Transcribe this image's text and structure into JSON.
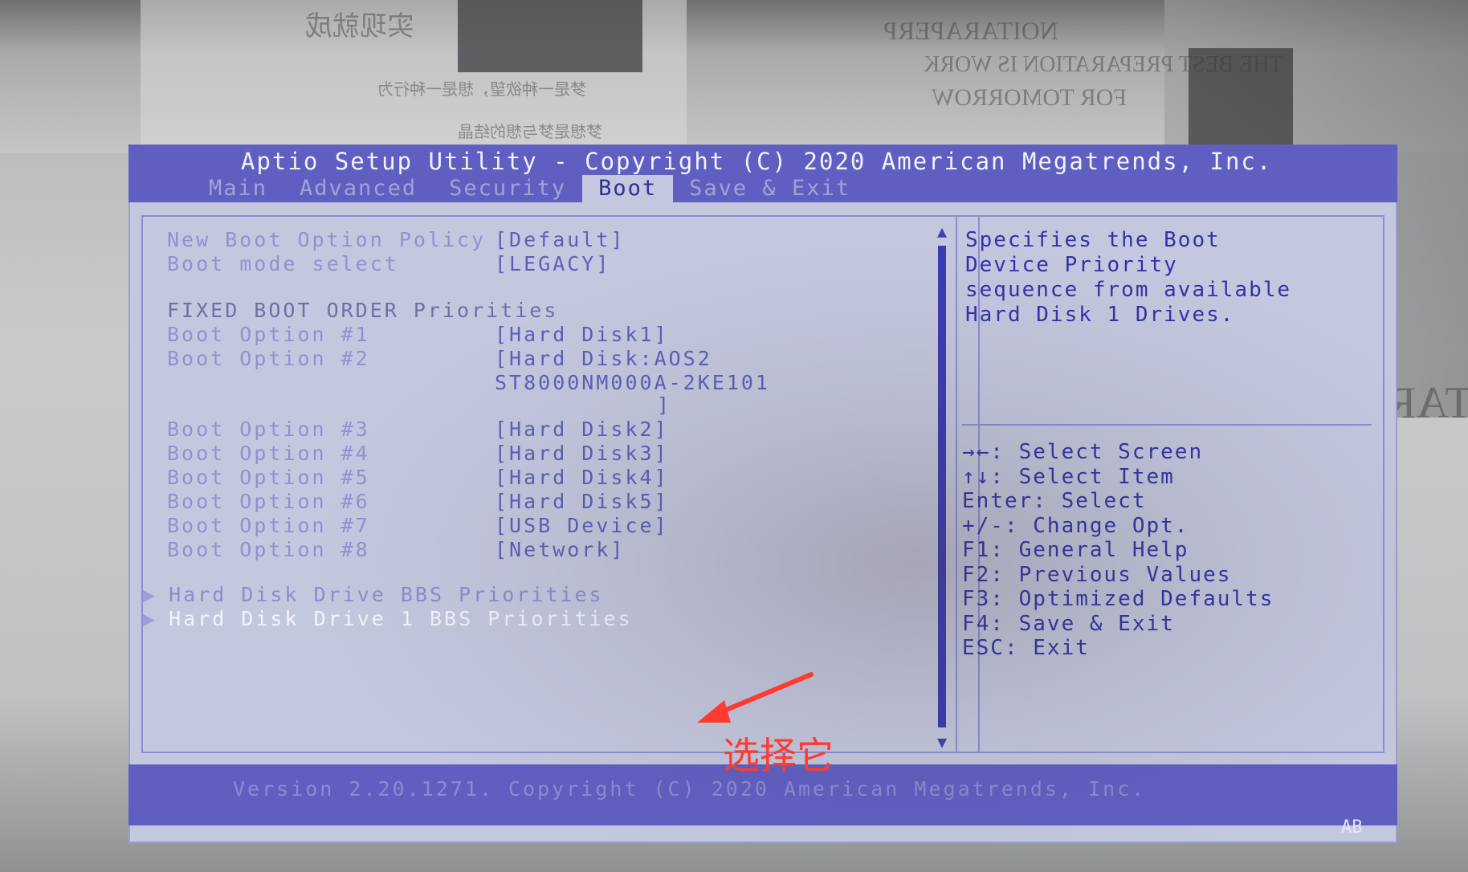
{
  "background": {
    "mirror_texts": [
      "实现就成",
      "梦是一种欲望，想是一种行为",
      "梦想是梦与想的结晶",
      "NOITARAPERP",
      "THE BEST PREPARATION IS WORK",
      "FOR TOMORROW",
      "NOITARTNECNOC"
    ]
  },
  "bios": {
    "title": "Aptio Setup Utility - Copyright (C) 2020 American Megatrends, Inc.",
    "tabs": [
      {
        "label": "Main",
        "active": false
      },
      {
        "label": "Advanced",
        "active": false
      },
      {
        "label": "Security",
        "active": false
      },
      {
        "label": "Boot",
        "active": true
      },
      {
        "label": "Save & Exit",
        "active": false
      }
    ],
    "settings": {
      "new_boot_option_policy": {
        "label": "New Boot Option Policy",
        "value": "[Default]"
      },
      "boot_mode_select": {
        "label": "Boot mode select",
        "value": "[LEGACY]"
      },
      "fixed_boot_order_header": "FIXED BOOT ORDER Priorities",
      "boot_options": [
        {
          "label": "Boot Option #1",
          "value": "[Hard Disk1]"
        },
        {
          "label": "Boot Option #2",
          "value": "[Hard Disk:AOS2",
          "value_line2": "ST8000NM000A-2KE101",
          "value_line3": "]"
        },
        {
          "label": "Boot Option #3",
          "value": "[Hard Disk2]"
        },
        {
          "label": "Boot Option #4",
          "value": "[Hard Disk3]"
        },
        {
          "label": "Boot Option #5",
          "value": "[Hard Disk4]"
        },
        {
          "label": "Boot Option #6",
          "value": "[Hard Disk5]"
        },
        {
          "label": "Boot Option #7",
          "value": "[USB Device]"
        },
        {
          "label": "Boot Option #8",
          "value": "[Network]"
        }
      ],
      "submenus": [
        {
          "label": "Hard Disk Drive BBS Priorities",
          "selected": false
        },
        {
          "label": "Hard Disk Drive 1 BBS Priorities",
          "selected": true
        }
      ]
    },
    "help_text": [
      "Specifies the Boot",
      "Device Priority",
      "sequence from available",
      "Hard Disk 1 Drives."
    ],
    "key_help": [
      "→←: Select Screen",
      "↑↓: Select Item",
      "Enter: Select",
      "+/-: Change Opt.",
      "F1: General Help",
      "F2: Previous Values",
      "F3: Optimized Defaults",
      "F4: Save & Exit",
      "ESC: Exit"
    ],
    "footer": "Version 2.20.1271. Copyright (C) 2020 American Megatrends, Inc.",
    "corner_code": "AB",
    "scroll_up_glyph": "▲",
    "scroll_down_glyph": "▼",
    "submenu_glyph": "▶"
  },
  "annotation": {
    "text": "选择它",
    "color": "#ff3b2f"
  }
}
